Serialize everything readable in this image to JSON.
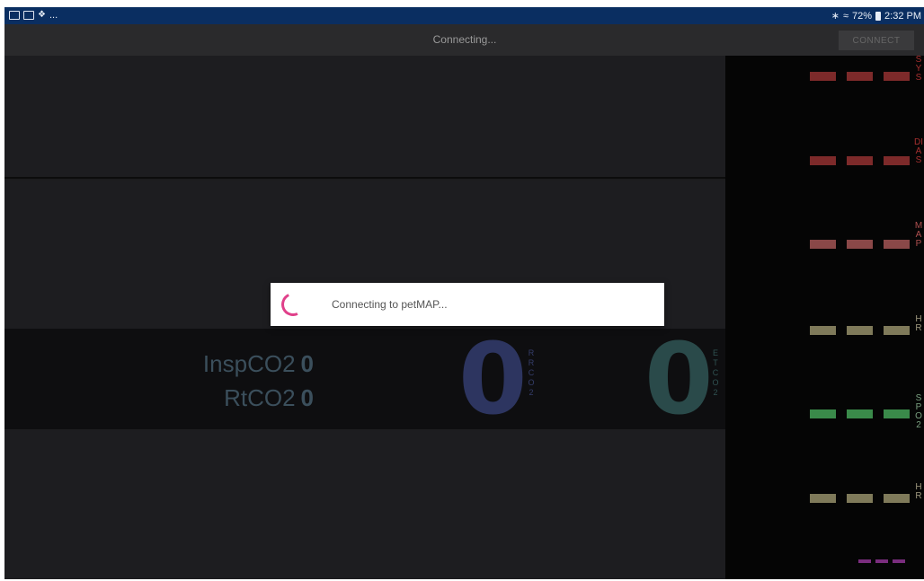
{
  "status_bar": {
    "left_icons": [
      "image-icon",
      "mail-icon",
      "cast-icon"
    ],
    "left_more": "...",
    "right_text": "72%",
    "time": "2:32 PM",
    "right_icons": [
      "bluetooth-icon",
      "wifi-icon",
      "battery-icon"
    ]
  },
  "action_bar": {
    "title": "Connecting...",
    "connect_label": "CONNECT"
  },
  "co2": {
    "insp_label": "InspCO2",
    "insp_value": "0",
    "rt_label": "RtCO2",
    "rt_value": "0",
    "rr_value": "0",
    "rr_label": "RRCO2",
    "etco2_value": "0",
    "etco2_label": "ETCO2"
  },
  "sidebar": {
    "vitals": [
      {
        "label": "SYS",
        "color": "#7d2a2a",
        "label_color": "#a83030"
      },
      {
        "label": "DIAS",
        "color": "#7d2a2a",
        "label_color": "#a83030"
      },
      {
        "label": "MAP",
        "color": "#8a4848",
        "label_color": "#b05050"
      },
      {
        "label": "HR",
        "color": "#7f7a5a",
        "label_color": "#a09a80"
      },
      {
        "label": "SPO2",
        "color": "#3a8a4a",
        "label_color": "#7aa080"
      },
      {
        "label": "HR",
        "color": "#7f7a5a",
        "label_color": "#a09a80"
      }
    ]
  },
  "dialog": {
    "message": "Connecting to petMAP..."
  },
  "colors": {
    "status_bar": "#0a2e61",
    "spinner": "#e0408a",
    "purple_indicator": "#7a2d7e"
  }
}
